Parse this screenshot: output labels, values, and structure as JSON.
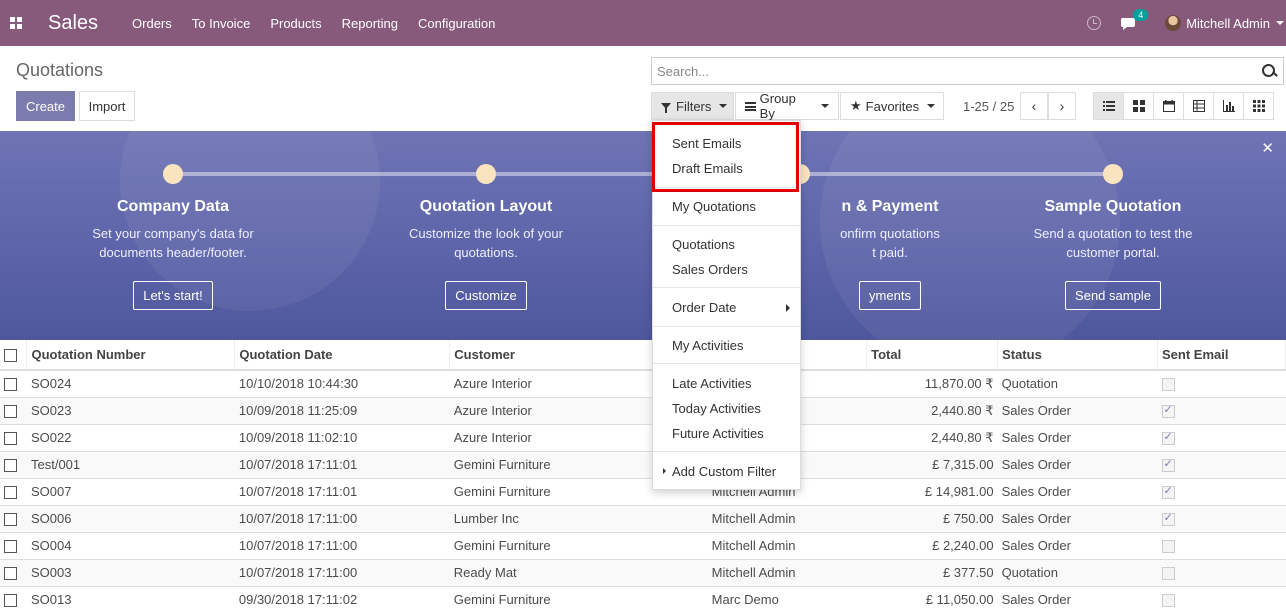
{
  "navbar": {
    "brand": "Sales",
    "menu": [
      "Orders",
      "To Invoice",
      "Products",
      "Reporting",
      "Configuration"
    ],
    "chat_badge": "4",
    "user": "Mitchell Admin"
  },
  "control_panel": {
    "title": "Quotations",
    "create_label": "Create",
    "import_label": "Import",
    "search_placeholder": "Search...",
    "filters_label": "Filters",
    "groupby_label": "Group By",
    "favorites_label": "Favorites",
    "pager": "1-25 / 25"
  },
  "banner": {
    "steps": [
      {
        "title": "Company Data",
        "desc1": "Set your company's data for",
        "desc2": "documents header/footer.",
        "button": "Let's start!"
      },
      {
        "title": "Quotation Layout",
        "desc1": "Customize the look of your",
        "desc2": "quotations.",
        "button": "Customize"
      },
      {
        "title": "n & Payment",
        "desc1": "onfirm quotations",
        "desc2": "t paid.",
        "button": "yments"
      },
      {
        "title": "Sample Quotation",
        "desc1": "Send a quotation to test the",
        "desc2": "customer portal.",
        "button": "Send sample"
      }
    ]
  },
  "table": {
    "headers": [
      "Quotation Number",
      "Quotation Date",
      "Customer",
      "",
      "Total",
      "Status",
      "Sent Email"
    ],
    "rows": [
      {
        "number": "SO024",
        "date": "10/10/2018 10:44:30",
        "customer": "Azure Interior",
        "salesperson": "",
        "total": "11,870.00 ₹",
        "status": "Quotation",
        "sent": false
      },
      {
        "number": "SO023",
        "date": "10/09/2018 11:25:09",
        "customer": "Azure Interior",
        "salesperson": "",
        "total": "2,440.80 ₹",
        "status": "Sales Order",
        "sent": true
      },
      {
        "number": "SO022",
        "date": "10/09/2018 11:02:10",
        "customer": "Azure Interior",
        "salesperson": "",
        "total": "2,440.80 ₹",
        "status": "Sales Order",
        "sent": true
      },
      {
        "number": "Test/001",
        "date": "10/07/2018 17:11:01",
        "customer": "Gemini Furniture",
        "salesperson": "",
        "total": "£ 7,315.00",
        "status": "Sales Order",
        "sent": true
      },
      {
        "number": "SO007",
        "date": "10/07/2018 17:11:01",
        "customer": "Gemini Furniture",
        "salesperson": "Mitchell Admin",
        "total": "£ 14,981.00",
        "status": "Sales Order",
        "sent": true
      },
      {
        "number": "SO006",
        "date": "10/07/2018 17:11:00",
        "customer": "Lumber Inc",
        "salesperson": "Mitchell Admin",
        "total": "£ 750.00",
        "status": "Sales Order",
        "sent": true
      },
      {
        "number": "SO004",
        "date": "10/07/2018 17:11:00",
        "customer": "Gemini Furniture",
        "salesperson": "Mitchell Admin",
        "total": "£ 2,240.00",
        "status": "Sales Order",
        "sent": false
      },
      {
        "number": "SO003",
        "date": "10/07/2018 17:11:00",
        "customer": "Ready Mat",
        "salesperson": "Mitchell Admin",
        "total": "£ 377.50",
        "status": "Quotation",
        "sent": false
      },
      {
        "number": "SO013",
        "date": "09/30/2018 17:11:02",
        "customer": "Gemini Furniture",
        "salesperson": "Marc Demo",
        "total": "£ 11,050.00",
        "status": "Sales Order",
        "sent": false
      }
    ]
  },
  "filters_dropdown": {
    "items": [
      "Sent Emails",
      "Draft Emails",
      "My Quotations",
      "Quotations",
      "Sales Orders",
      "Order Date",
      "My Activities",
      "Late Activities",
      "Today Activities",
      "Future Activities",
      "Add Custom Filter"
    ]
  },
  "colors": {
    "navbar": "#875a7b",
    "primary": "#7c7bad",
    "highlight": "#e00000"
  }
}
